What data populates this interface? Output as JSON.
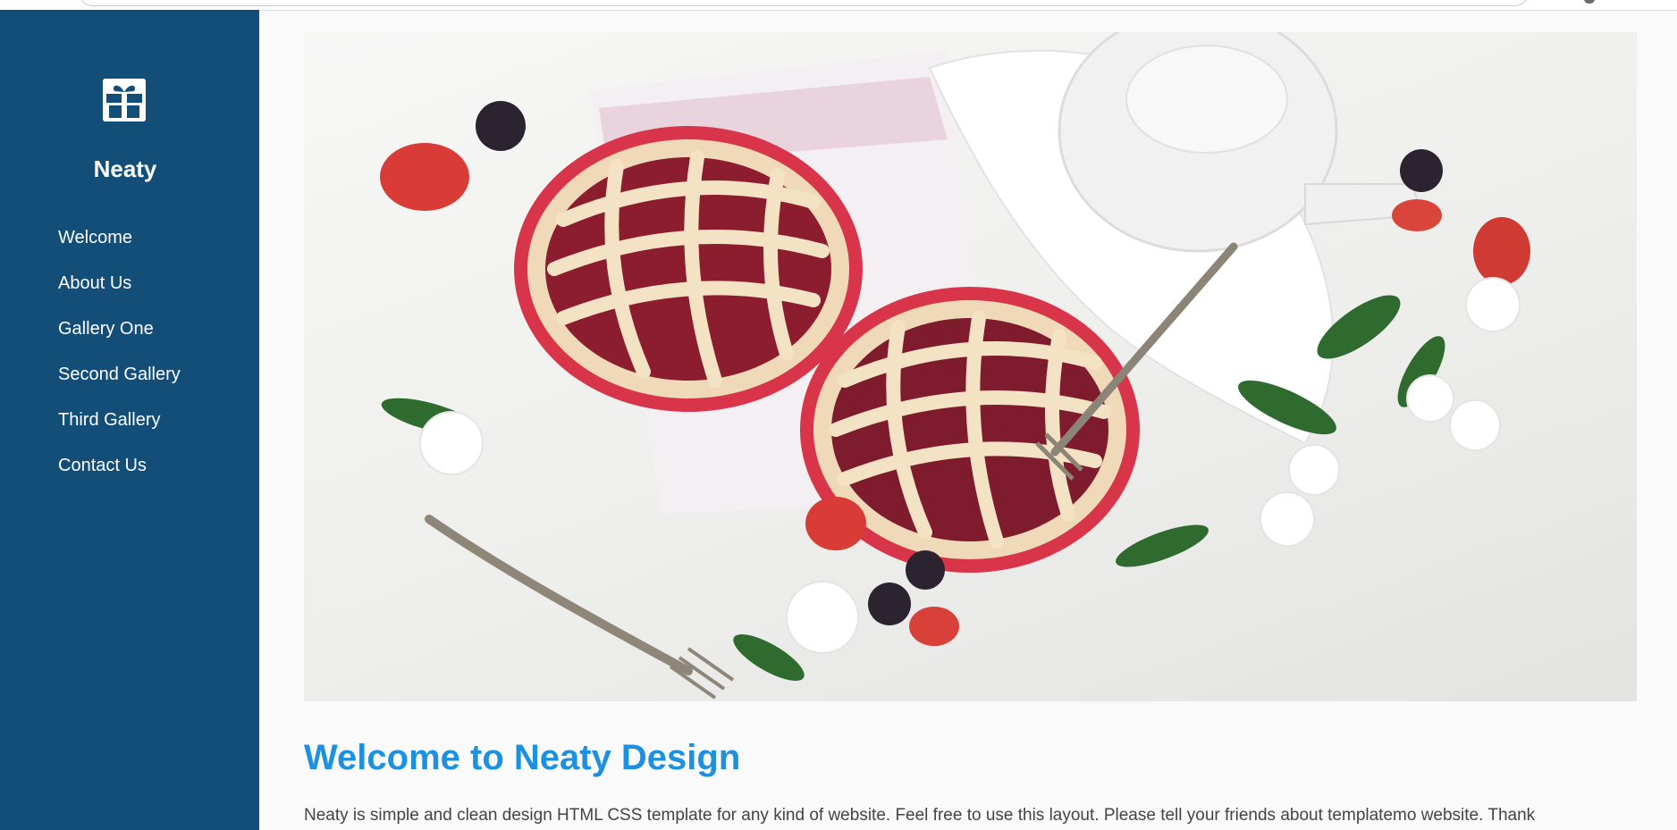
{
  "brand": {
    "name": "Neaty",
    "logo_icon": "gift-icon"
  },
  "nav": {
    "items": [
      {
        "label": "Welcome"
      },
      {
        "label": "About Us"
      },
      {
        "label": "Gallery One"
      },
      {
        "label": "Second Gallery"
      },
      {
        "label": "Third Gallery"
      },
      {
        "label": "Contact Us"
      }
    ]
  },
  "main": {
    "heading": "Welcome to Neaty Design",
    "intro": "Neaty is simple and clean design HTML CSS template for any kind of website. Feel free to use this layout. Please tell your friends about templatemo website. Thank"
  },
  "colors": {
    "sidebar": "#124e78",
    "heading": "#1e90e0",
    "body_text": "#444444",
    "background": "#fafafa"
  }
}
